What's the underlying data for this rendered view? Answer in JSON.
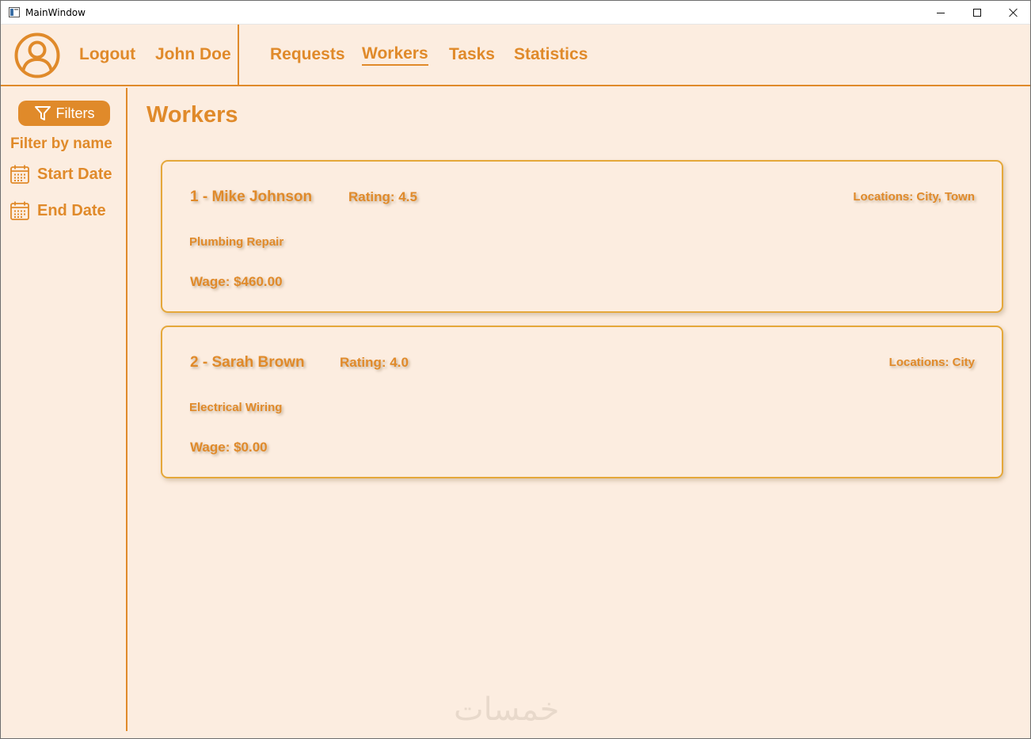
{
  "window": {
    "title": "MainWindow"
  },
  "header": {
    "logout_label": "Logout",
    "user_name": "John Doe",
    "nav": {
      "requests": "Requests",
      "workers": "Workers",
      "tasks": "Tasks",
      "statistics": "Statistics"
    },
    "active_tab": "Workers"
  },
  "sidebar": {
    "filters_label": "Filters",
    "filter_by_name": "Filter by name",
    "start_date": "Start Date",
    "end_date": "End Date"
  },
  "main": {
    "title": "Workers",
    "workers": [
      {
        "name": "1 - Mike Johnson",
        "rating": "Rating: 4.5",
        "locations": "Locations: City, Town",
        "service": "Plumbing Repair",
        "wage": "Wage: $460.00"
      },
      {
        "name": "2 - Sarah Brown",
        "rating": "Rating: 4.0",
        "locations": "Locations: City",
        "service": "Electrical Wiring",
        "wage": "Wage: $0.00"
      }
    ]
  },
  "watermark": "خمسات",
  "colors": {
    "accent": "#e08a2a",
    "background": "#fcede0",
    "card_border": "#e5a83a"
  },
  "icons": {
    "avatar": "user-circle-icon",
    "filters": "funnel-icon",
    "dates": "calendar-icon",
    "window_controls": [
      "minimize-icon",
      "maximize-icon",
      "close-icon"
    ]
  }
}
